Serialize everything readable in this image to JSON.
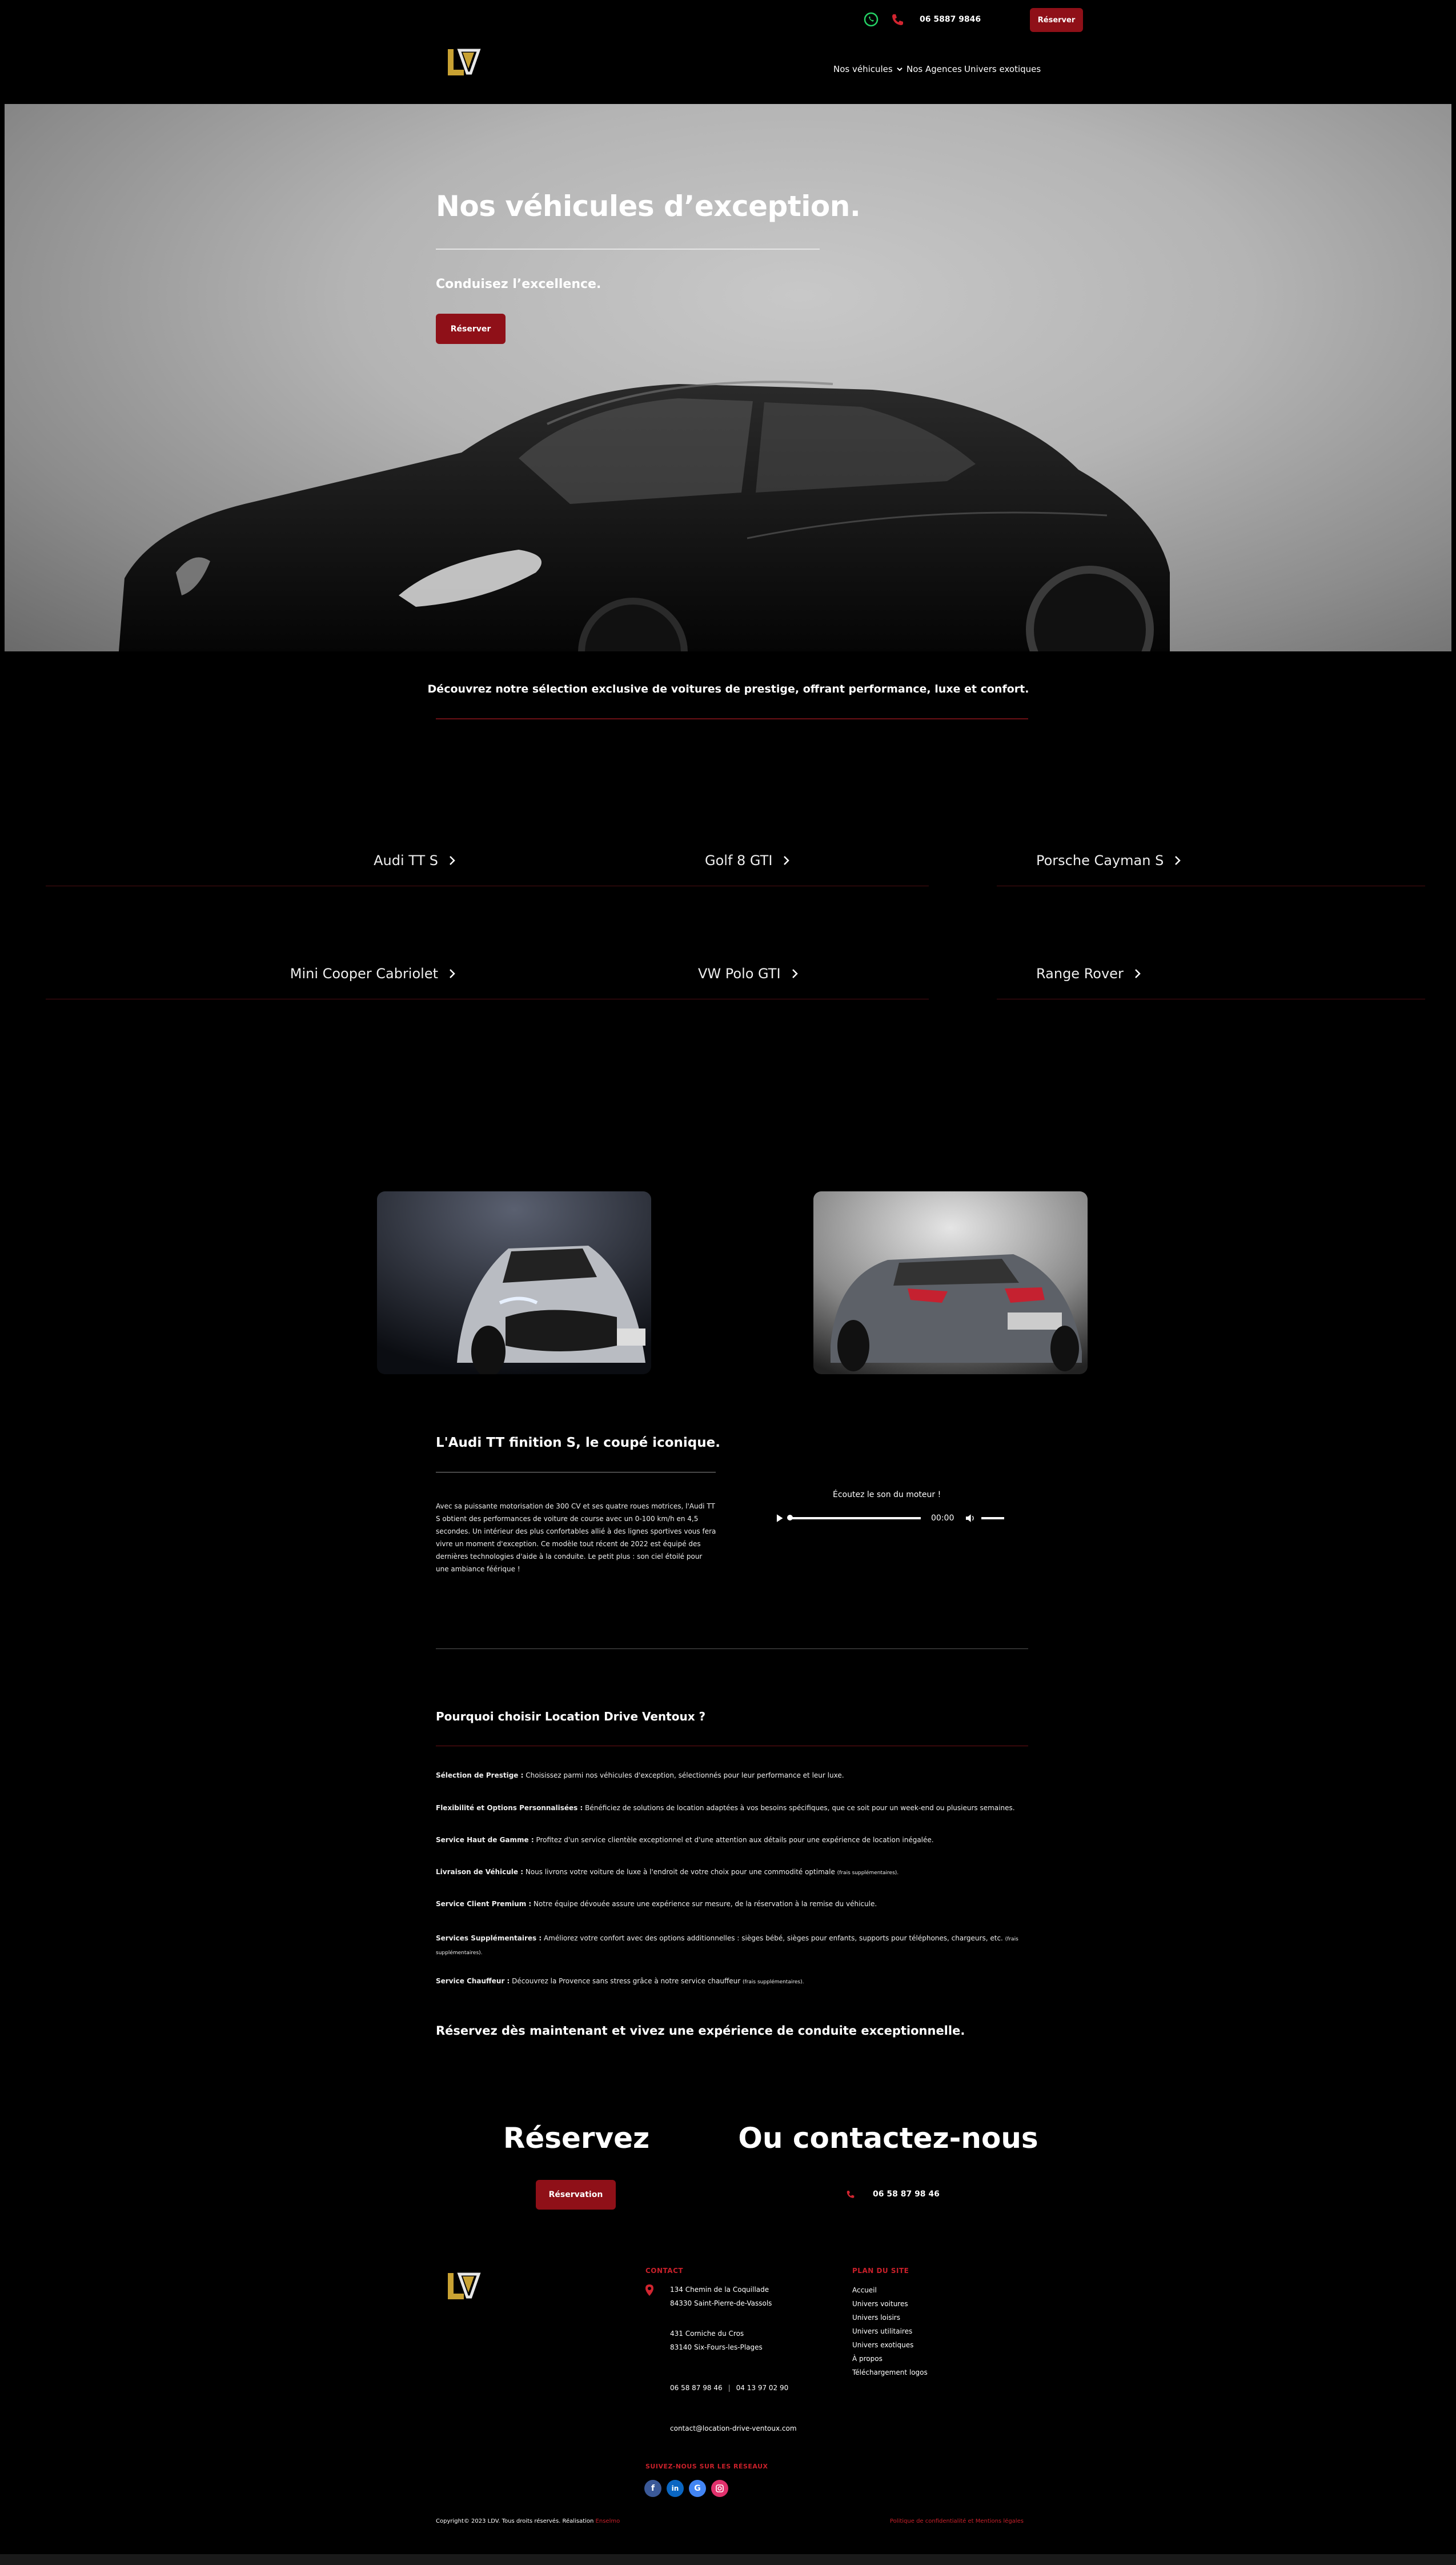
{
  "topbar": {
    "phone": "06 5887 9846",
    "reserve_label": "Réserver"
  },
  "nav": {
    "items": [
      "Nos véhicules",
      "Nos Agences",
      "Univers exotiques"
    ]
  },
  "hero": {
    "title": "Nos véhicules d’exception.",
    "subtitle": "Conduisez l’excellence.",
    "button": "Réserver"
  },
  "intro": "Découvrez notre sélection exclusive de voitures de prestige, offrant performance, luxe et confort.",
  "vehicles": [
    "Audi TT S",
    "Golf 8 GTI",
    "Porsche Cayman S",
    "Mini Cooper Cabriolet",
    "VW Polo GTI",
    "Range Rover"
  ],
  "audi": {
    "title": "L'Audi TT finition S, le coupé iconique.",
    "body": "Avec sa puissante motorisation de 300 CV et ses quatre roues motrices, l'Audi TT S obtient des performances de voiture de course avec un 0-100 km/h en 4,5 secondes. Un intérieur des plus confortables allié à des lignes sportives vous fera vivre un moment d'exception. Ce modèle tout récent de 2022 est équipé des dernières technologies d'aide à la conduite. Le petit plus : son ciel étoilé pour une ambiance féérique !",
    "audio_label": "Écoutez le son du moteur !",
    "audio_time": "00:00"
  },
  "why": {
    "title": "Pourquoi choisir Location Drive Ventoux ?",
    "items": [
      {
        "head": "Sélection de Prestige :",
        "text": " Choisissez parmi nos véhicules d'exception, sélectionnés pour leur performance et leur luxe.",
        "note": ""
      },
      {
        "head": "Flexibilité et Options Personnalisées :",
        "text": " Bénéficiez de solutions de location adaptées à vos besoins spécifiques, que ce soit pour un week-end ou plusieurs semaines.",
        "note": ""
      },
      {
        "head": "Service Haut de Gamme :",
        "text": " Profitez d'un service clientèle exceptionnel et d'une attention aux détails pour une expérience de location inégalée.",
        "note": ""
      },
      {
        "head": "Livraison de Véhicule :",
        "text": " Nous livrons votre voiture de luxe à l'endroit de votre choix pour une commodité optimale ",
        "note": "(frais supplémentaires)."
      },
      {
        "head": "Service Client Premium :",
        "text": " Notre équipe dévouée assure une expérience sur mesure, de la réservation à la remise du véhicule.",
        "note": ""
      },
      {
        "head": "Services Supplémentaires :",
        "text": " Améliorez votre confort avec des options additionnelles : sièges bébé, sièges pour enfants, supports pour téléphones, chargeurs, etc. ",
        "note": "(frais supplémentaires)."
      },
      {
        "head": "Service Chauffeur :",
        "text": " Découvrez la Provence sans stress grâce à notre service chauffeur ",
        "note": "(frais supplémentaires)."
      }
    ],
    "closing": "Réservez dès maintenant et vivez une expérience de conduite exceptionnelle."
  },
  "cta": {
    "left_title": "Réservez",
    "left_button": "Réservation",
    "right_title": "Ou contactez-nous",
    "phone": "06 58 87 98 46"
  },
  "footer": {
    "contact_label": "CONTACT",
    "address1_line1": "134 Chemin de la Coquillade",
    "address1_line2": "84330 Saint-Pierre-de-Vassols",
    "address2_line1": "431 Corniche du Cros",
    "address2_line2": "83140 Six-Fours-les-Plages",
    "phone1": "06 58 87 98 46",
    "phone2": "04 13 97 02 90",
    "email": "contact@location-drive-ventoux.com",
    "social_label": "SUIVEZ-NOUS SUR LES RÉSEAUX",
    "plan_label": "PLAN DU SITE",
    "plan_items": [
      "Accueil",
      "Univers voitures",
      "Univers loisirs",
      "Univers utilitaires",
      "Univers exotiques",
      "À propos",
      "Téléchargement logos"
    ],
    "copyright": "Copyright© 2023 LDV. Tous droits réservés. Réalisation ",
    "copyright_link": "Enselmo",
    "privacy": "Politique de confidentialité et Mentions légales"
  },
  "colors": {
    "accent": "#8f1018",
    "accent_text": "#c8202a",
    "gold": "#c9a233"
  },
  "icons": [
    "whatsapp-icon",
    "phone-icon",
    "chevron-down-icon",
    "chevron-right-icon",
    "play-icon",
    "volume-icon",
    "location-pin-icon",
    "facebook-icon",
    "linkedin-icon",
    "google-icon",
    "instagram-icon"
  ]
}
